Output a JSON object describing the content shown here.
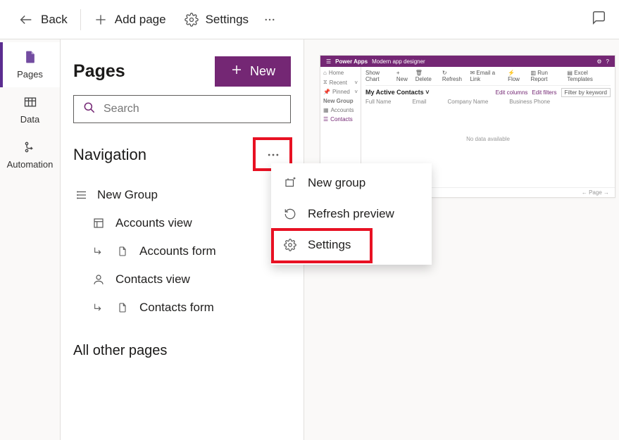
{
  "topbar": {
    "back_label": "Back",
    "addpage_label": "Add page",
    "settings_label": "Settings"
  },
  "rail": {
    "pages_label": "Pages",
    "data_label": "Data",
    "automation_label": "Automation"
  },
  "panel": {
    "title": "Pages",
    "new_label": "New",
    "search_placeholder": "Search",
    "navigation_title": "Navigation",
    "all_other_title": "All other pages",
    "nav": {
      "group_label": "New Group",
      "items": [
        {
          "label": "Accounts view"
        },
        {
          "label": "Accounts form"
        },
        {
          "label": "Contacts view"
        },
        {
          "label": "Contacts form"
        }
      ]
    }
  },
  "menu": {
    "new_group_label": "New group",
    "refresh_label": "Refresh preview",
    "settings_label": "Settings"
  },
  "preview": {
    "app_brand": "Power Apps",
    "app_name": "Modern app designer",
    "side": {
      "home": "Home",
      "recent": "Recent",
      "pinned": "Pinned",
      "group": "New Group",
      "accounts": "Accounts",
      "contacts": "Contacts"
    },
    "cmd": {
      "show_chart": "Show Chart",
      "new": "New",
      "delete": "Delete",
      "refresh": "Refresh",
      "email_link": "Email a Link",
      "flow": "Flow",
      "run_report": "Run Report",
      "excel_templates": "Excel Templates"
    },
    "view_title": "My Active Contacts",
    "edit_columns": "Edit columns",
    "edit_filters": "Edit filters",
    "filter_placeholder": "Filter by keyword",
    "col_fullname": "Full Name",
    "col_email": "Email",
    "col_company": "Company Name",
    "col_phone": "Business Phone",
    "empty_text": "No data available",
    "footer_page": "Page"
  }
}
